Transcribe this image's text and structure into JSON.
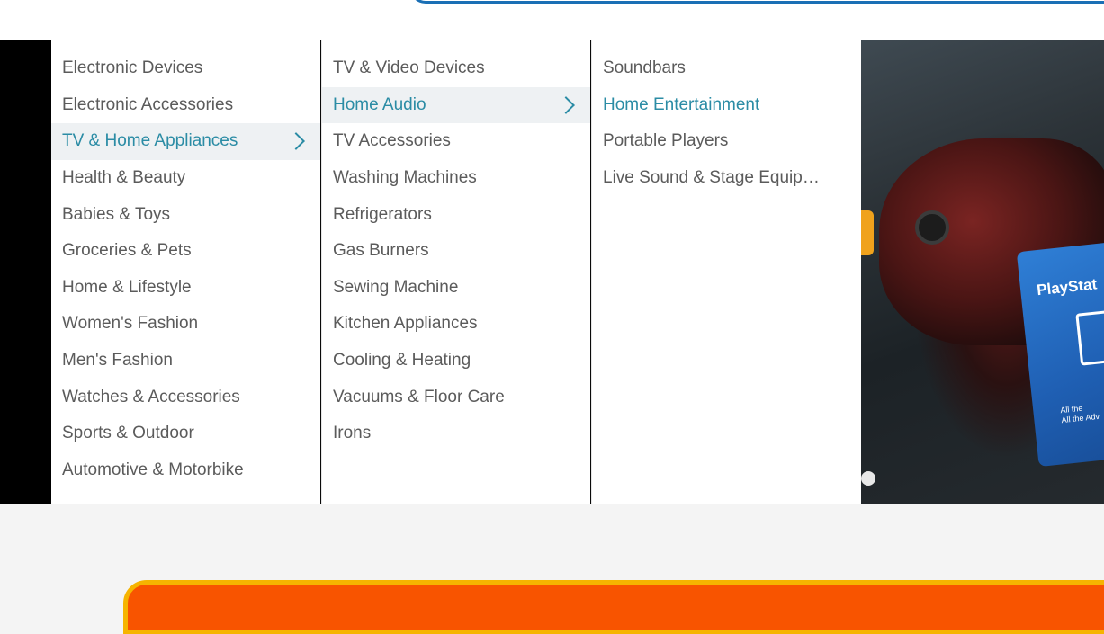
{
  "colors": {
    "accent": "#2b8ca5",
    "text": "#5b5b5b",
    "active_bg": "#eef1f3",
    "promo_orange": "#f85400",
    "promo_border": "#f6b400",
    "search_border": "#1a6fb5"
  },
  "menu": {
    "level1": [
      {
        "label": "Electronic Devices"
      },
      {
        "label": "Electronic Accessories"
      },
      {
        "label": "TV & Home Appliances",
        "active": true
      },
      {
        "label": "Health & Beauty"
      },
      {
        "label": "Babies & Toys"
      },
      {
        "label": "Groceries & Pets"
      },
      {
        "label": "Home & Lifestyle"
      },
      {
        "label": "Women's Fashion"
      },
      {
        "label": "Men's Fashion"
      },
      {
        "label": "Watches & Accessories"
      },
      {
        "label": "Sports & Outdoor"
      },
      {
        "label": "Automotive & Motorbike"
      }
    ],
    "level2": [
      {
        "label": "TV & Video Devices"
      },
      {
        "label": "Home Audio",
        "active": true
      },
      {
        "label": "TV Accessories"
      },
      {
        "label": "Washing Machines"
      },
      {
        "label": "Refrigerators"
      },
      {
        "label": "Gas Burners"
      },
      {
        "label": "Sewing Machine"
      },
      {
        "label": "Kitchen Appliances"
      },
      {
        "label": "Cooling & Heating"
      },
      {
        "label": "Vacuums & Floor Care"
      },
      {
        "label": "Irons"
      }
    ],
    "level3": [
      {
        "label": "Soundbars"
      },
      {
        "label": "Home Entertainment",
        "hover": true
      },
      {
        "label": "Portable Players"
      },
      {
        "label": "Live Sound & Stage Equipm…"
      }
    ]
  },
  "banner": {
    "card_title": "PlayStat",
    "card_sub_line1": "All the",
    "card_sub_line2": "All the Adv"
  }
}
